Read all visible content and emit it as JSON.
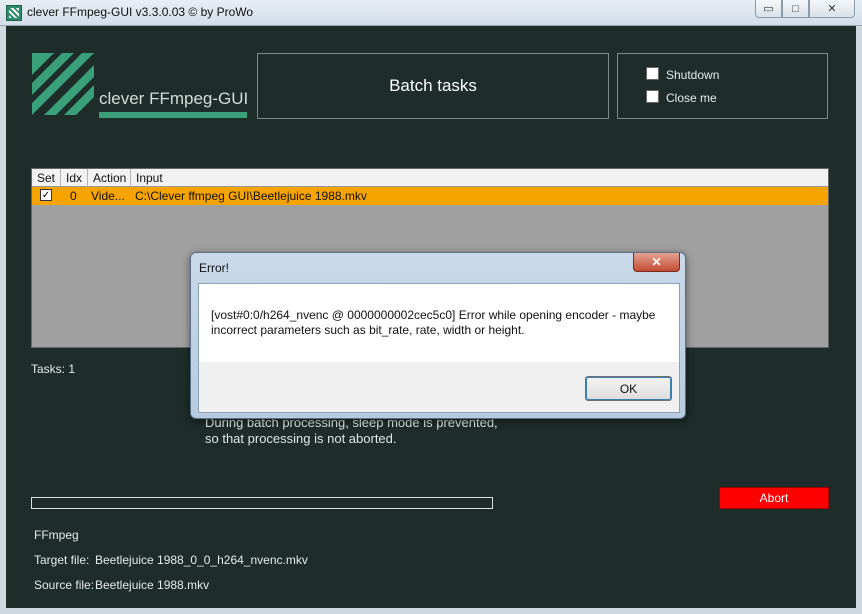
{
  "window": {
    "title": "clever FFmpeg-GUI v3.3.0.03   © by ProWo",
    "minimize": "▭",
    "maximize": "□",
    "close": "✕"
  },
  "logo": {
    "text": "clever FFmpeg-GUI"
  },
  "header": {
    "title": "Batch tasks"
  },
  "options": {
    "shutdown_label": "Shutdown",
    "close_label": "Close me",
    "shutdown_checked": false,
    "close_checked": false
  },
  "table": {
    "columns": [
      "Set",
      "Idx",
      "Action",
      "Input"
    ],
    "rows": [
      {
        "set_mark": "✓",
        "idx": "0",
        "action": "Vide...",
        "input": "C:\\Clever ffmpeg GUI\\Beetlejuice 1988.mkv"
      }
    ]
  },
  "tasks": {
    "label": "Tasks:",
    "count": "1"
  },
  "sleep_note": {
    "line1": "During batch processing, sleep mode is prevented,",
    "line2": "so that processing is not aborted."
  },
  "progress": {
    "fraction": 0
  },
  "abort_label": "Abort",
  "info": {
    "ffmpeg_label": "FFmpeg",
    "target_label": "Target file:",
    "target_value": "Beetlejuice 1988_0_0_h264_nvenc.mkv",
    "source_label": "Source file:",
    "source_value": "Beetlejuice 1988.mkv"
  },
  "dialog": {
    "title": "Error!",
    "close": "✕",
    "message": "[vost#0:0/h264_nvenc @ 0000000002cec5c0] Error while opening encoder - maybe incorrect parameters such as bit_rate, rate, width or height.",
    "ok_label": "OK"
  },
  "colors": {
    "client_bg": "#1e2c2a",
    "accent": "#3aa07a",
    "row_highlight": "#f8a400",
    "abort": "#ff0000"
  }
}
